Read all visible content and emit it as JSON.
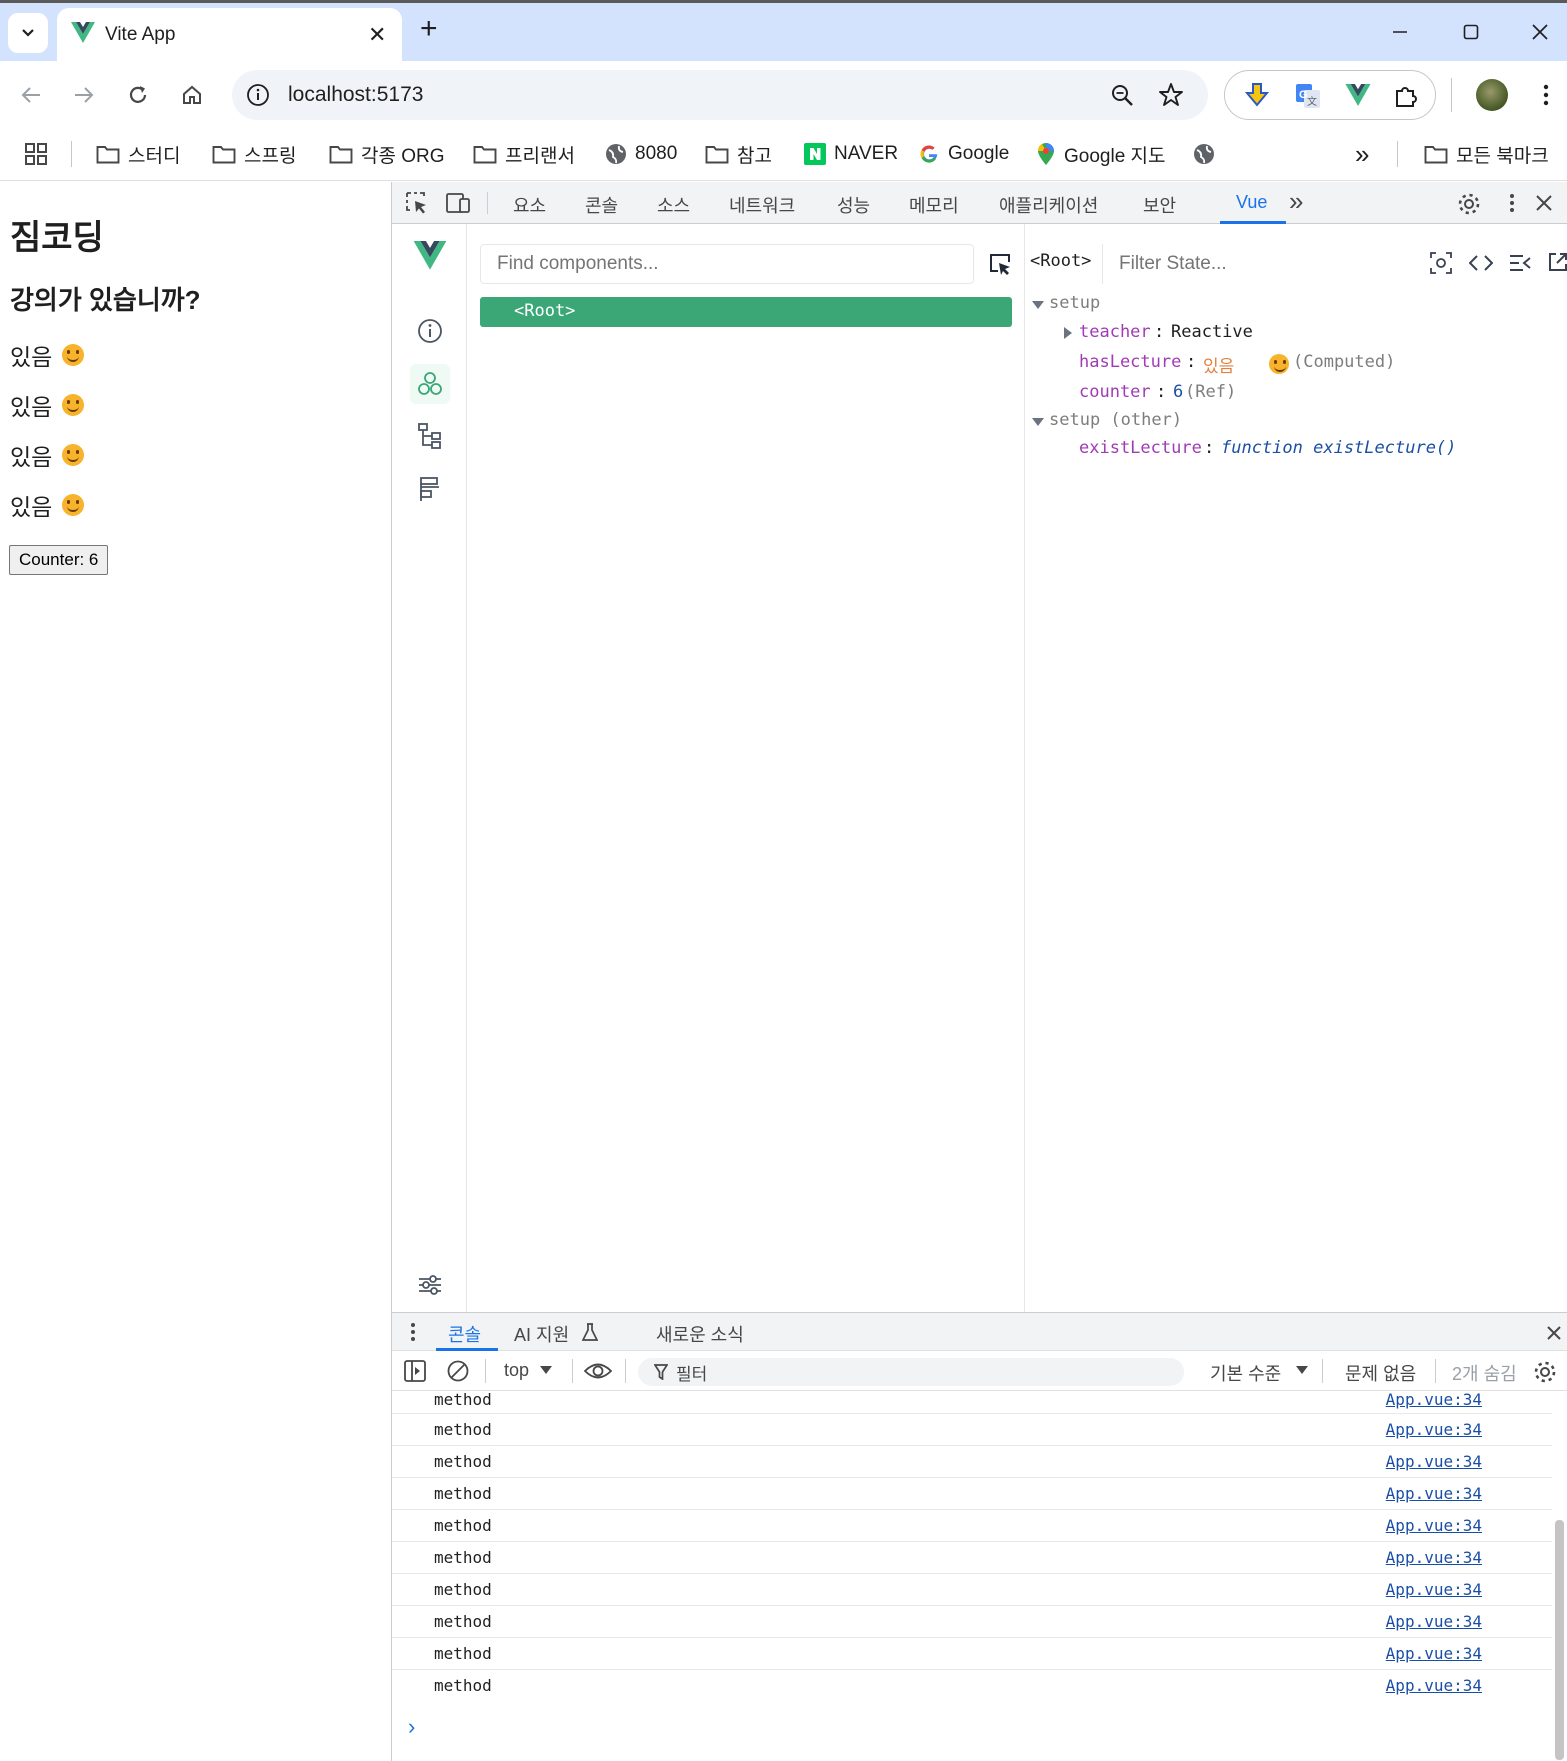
{
  "browser": {
    "tab_title": "Vite App",
    "tab_close": "✕",
    "new_tab": "+",
    "url": "localhost:5173"
  },
  "bookmarks": {
    "items": [
      {
        "label": "스터디",
        "icon": "folder-icon"
      },
      {
        "label": "스프링",
        "icon": "folder-icon"
      },
      {
        "label": "각종 ORG",
        "icon": "folder-icon"
      },
      {
        "label": "프리랜서",
        "icon": "folder-icon"
      },
      {
        "label": "8080",
        "icon": "globe-icon"
      },
      {
        "label": "참고",
        "icon": "folder-icon"
      },
      {
        "label": "NAVER",
        "icon": "naver-icon"
      },
      {
        "label": "Google",
        "icon": "google-icon"
      },
      {
        "label": "Google 지도",
        "icon": "google-maps-icon"
      }
    ],
    "more": "»",
    "all_bookmarks": "모든 북마크"
  },
  "page": {
    "title": "짐코딩",
    "question": "강의가 있습니까?",
    "lines": [
      "있음",
      "있음",
      "있음",
      "있음"
    ],
    "counter_button": "Counter: 6"
  },
  "devtools": {
    "tabs": [
      "요소",
      "콘솔",
      "소스",
      "네트워크",
      "성능",
      "메모리",
      "애플리케이션",
      "보안",
      "Vue"
    ],
    "active_tab": "Vue",
    "more_tabs": "»"
  },
  "vue": {
    "find_placeholder": "Find components...",
    "root_row": "<Root>",
    "inspected_component": "<Root>",
    "filter_placeholder": "Filter State...",
    "state": {
      "setup_label": "setup",
      "teacher_key": "teacher",
      "teacher_value": "Reactive",
      "haslecture_key": "hasLecture",
      "haslecture_value": "있음",
      "haslecture_type": "(Computed)",
      "counter_key": "counter",
      "counter_value": "6",
      "counter_type": "(Ref)",
      "setup_other_label": "setup (other)",
      "existlecture_key": "existLecture",
      "existlecture_value": "function existLecture()"
    },
    "colon": ":"
  },
  "drawer": {
    "tabs": [
      "콘솔",
      "AI 지원",
      "새로운 소식"
    ],
    "active_tab": "콘솔",
    "context": "top",
    "filter_label": "필터",
    "levels": "기본 수준",
    "issues": "문제 없음",
    "hidden": "2개 숨김"
  },
  "console": {
    "rows": [
      {
        "msg": "method",
        "src": "App.vue:34"
      },
      {
        "msg": "method",
        "src": "App.vue:34"
      },
      {
        "msg": "method",
        "src": "App.vue:34"
      },
      {
        "msg": "method",
        "src": "App.vue:34"
      },
      {
        "msg": "method",
        "src": "App.vue:34"
      },
      {
        "msg": "method",
        "src": "App.vue:34"
      },
      {
        "msg": "method",
        "src": "App.vue:34"
      },
      {
        "msg": "method",
        "src": "App.vue:34"
      },
      {
        "msg": "method",
        "src": "App.vue:34"
      },
      {
        "msg": "method",
        "src": "App.vue:34"
      }
    ],
    "prompt": "›"
  },
  "colors": {
    "tabstrip": "#d3e3fd",
    "vue_green": "#3ba776",
    "devtools_accent": "#1a73e8",
    "state_key": "#a03bb5",
    "link_blue": "#1a4ea6"
  }
}
